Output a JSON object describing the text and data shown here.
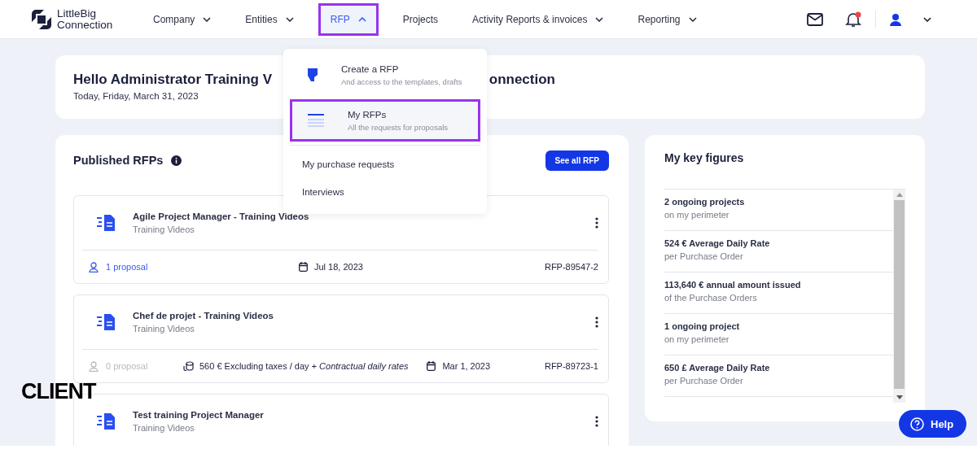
{
  "brand": {
    "name_line1": "LittleBig",
    "name_line2": "Connection"
  },
  "nav": [
    {
      "label": "Company",
      "has_menu": true,
      "selected": false
    },
    {
      "label": "Entities",
      "has_menu": true,
      "selected": false
    },
    {
      "label": "RFP",
      "has_menu": true,
      "selected": true
    },
    {
      "label": "Projects",
      "has_menu": false,
      "selected": false
    },
    {
      "label": "Activity Reports & invoices",
      "has_menu": true,
      "selected": false
    },
    {
      "label": "Reporting",
      "has_menu": true,
      "selected": false
    }
  ],
  "header_actions": {
    "notification_unread": true
  },
  "greeting": {
    "title_left": "Hello Administrator Training V",
    "title_right": "onnection",
    "date": "Today, Friday, March 31, 2023"
  },
  "rfp_menu": {
    "items": [
      {
        "kind": "rich",
        "title": "Create a RFP",
        "subtitle": "And access to the templates, drafts",
        "selected": false
      },
      {
        "kind": "rich",
        "title": "My RFPs",
        "subtitle": "All the requests for proposals",
        "selected": true
      },
      {
        "kind": "plain",
        "title": "My purchase requests",
        "selected": false
      },
      {
        "kind": "plain",
        "title": "Interviews",
        "selected": false
      }
    ]
  },
  "published_rfps": {
    "title": "Published RFPs",
    "button": "See all RFP",
    "items": [
      {
        "title": "Agile Project Manager - Training Videos",
        "subtitle": "Training Videos",
        "proposals": "1 proposal",
        "has_proposals": true,
        "date": "Jul 18, 2023",
        "ref": "RFP-89547-2"
      },
      {
        "title": "Chef de projet - Training Videos",
        "subtitle": "Training Videos",
        "proposals": "0 proposal",
        "has_proposals": false,
        "rate": "560 € Excluding taxes / day",
        "rate_note": "+ Contractual daily rates",
        "date": "Mar 1, 2023",
        "ref": "RFP-89723-1"
      },
      {
        "title": "Test training Project Manager",
        "subtitle": "Training Videos"
      }
    ]
  },
  "key_figures": {
    "title": "My key figures",
    "items": [
      {
        "value": "2 ongoing projects",
        "caption": "on my perimeter"
      },
      {
        "value": "524 € Average Daily Rate",
        "caption": "per Purchase Order"
      },
      {
        "value": "113,640 € annual amount issued",
        "caption": "of the Purchase Orders"
      },
      {
        "value": "1 ongoing project",
        "caption": "on my perimeter"
      },
      {
        "value": "650 £ Average Daily Rate",
        "caption": "per Purchase Order"
      }
    ]
  },
  "overlay_label": "CLIENT",
  "help_button": "Help"
}
